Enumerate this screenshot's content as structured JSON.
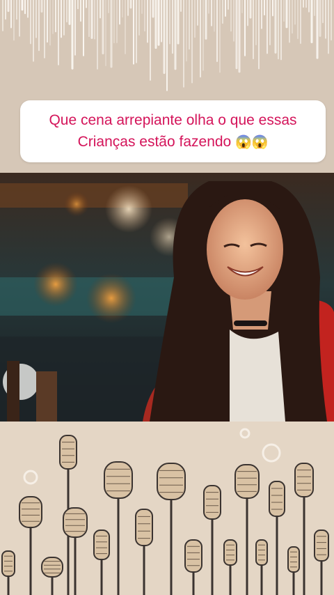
{
  "caption": {
    "line1": "Que cena arrepiante olha o que essas",
    "line2": "Crianças estão fazendo",
    "emoji": "😱😱",
    "color": "#d4145a"
  },
  "video": {
    "subject": "smiling-girl-photo"
  },
  "decor": {
    "top": "audio-waveform-graphic",
    "bottom": "vintage-microphones-illustration",
    "background_color": "#d8cabb"
  }
}
